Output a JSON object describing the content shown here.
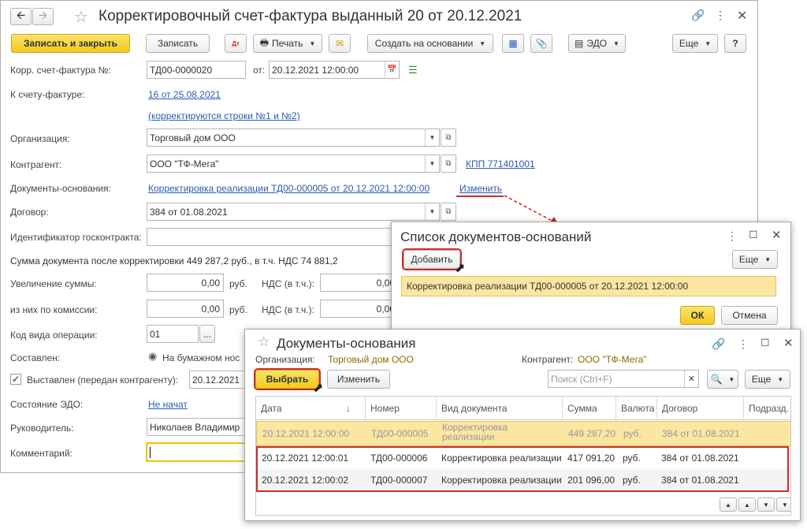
{
  "main": {
    "title": "Корректировочный счет-фактура выданный 20 от 20.12.2021",
    "toolbar": {
      "save_close": "Записать и закрыть",
      "save": "Записать",
      "print": "Печать",
      "create_based": "Создать на основании",
      "edo": "ЭДО",
      "more": "Еще",
      "help": "?"
    },
    "labels": {
      "number": "Корр. счет-фактура №:",
      "from": "от:",
      "invoice": "К счету-фактуре:",
      "org": "Организация:",
      "counterparty": "Контрагент:",
      "base_docs": "Документы-основания:",
      "contract": "Договор:",
      "gov_id": "Идентификатор госконтракта:",
      "sum_after": "Сумма документа после корректировки 449 287,2 руб., в т.ч. НДС 74 881,2",
      "increase": "Увеличение суммы:",
      "commission": "из них по комиссии:",
      "rub1": "руб.",
      "rub2": "руб.",
      "vat1": "НДС (в т.ч.):",
      "vat2": "НДС (в т.ч.):",
      "op_code": "Код вида операции:",
      "composed": "Составлен:",
      "issued": "Выставлен (передан контрагенту):",
      "edo_state": "Состояние ЭДО:",
      "head": "Руководитель:",
      "comment": "Комментарий:"
    },
    "values": {
      "number": "ТД00-0000020",
      "date": "20.12.2021 12:00:00",
      "invoice_link": "16 от 25.08.2021",
      "corrected_rows": "(корректируются строки №1 и №2)",
      "org": "Торговый дом ООО",
      "counterparty": "ООО \"ТФ-Мега\"",
      "kpp": "КПП 771401001",
      "base_doc_link": "Корректировка реализации ТД00-000005 от 20.12.2021 12:00:00",
      "change_link": "Изменить",
      "contract": "384 от 01.08.2021",
      "gov_id": "",
      "increase": "0,00",
      "increase_vat": "0,00",
      "commission": "0,00",
      "commission_vat": "0,00",
      "op_code": "01",
      "op_code_btn": "...",
      "composed_option": "На бумажном нос",
      "issued_date": "20.12.2021",
      "edo_state": "Не начат",
      "head": "Николаев Владимир",
      "comment": ""
    }
  },
  "list_dialog": {
    "title": "Список документов-оснований",
    "add": "Добавить",
    "more": "Еще",
    "item": "Корректировка реализации ТД00-000005 от 20.12.2021 12:00:00",
    "ok": "ОК",
    "cancel": "Отмена"
  },
  "select_dialog": {
    "title": "Документы-основания",
    "org_label": "Организация:",
    "org_value": "Торговый дом ООО",
    "cp_label": "Контрагент:",
    "cp_value": "ООО \"ТФ-Мега\"",
    "select": "Выбрать",
    "change": "Изменить",
    "search_placeholder": "Поиск (Ctrl+F)",
    "more": "Еще",
    "columns": [
      "Дата",
      "Номер",
      "Вид документа",
      "Сумма",
      "Валюта",
      "Договор",
      "Подразд."
    ],
    "rows": [
      [
        "20.12.2021 12:00:00",
        "ТД00-000005",
        "Корректировка реализации",
        "449 287,20",
        "руб.",
        "384 от 01.08.2021",
        ""
      ],
      [
        "20.12.2021 12:00:01",
        "ТД00-000006",
        "Корректировка реализации",
        "417 091,20",
        "руб.",
        "384 от 01.08.2021",
        ""
      ],
      [
        "20.12.2021 12:00:02",
        "ТД00-000007",
        "Корректировка реализации",
        "201 096,00",
        "руб.",
        "384 от 01.08.2021",
        ""
      ]
    ]
  },
  "colors": {
    "accent_yellow": "#f2c91d",
    "highlight_row": "#fbe6a2",
    "link": "#2a5bb0",
    "red_frame": "#d22b2b"
  },
  "icons": [
    "back-arrow-icon",
    "forward-arrow-icon",
    "star-icon",
    "link-icon",
    "more-icon",
    "maximize-icon",
    "close-icon",
    "printer-icon",
    "envelope-icon",
    "calendar-icon",
    "dropdown-arrow-icon",
    "open-form-icon",
    "cursor-icon",
    "search-icon",
    "checkbox-icon",
    "radio-icon"
  ]
}
